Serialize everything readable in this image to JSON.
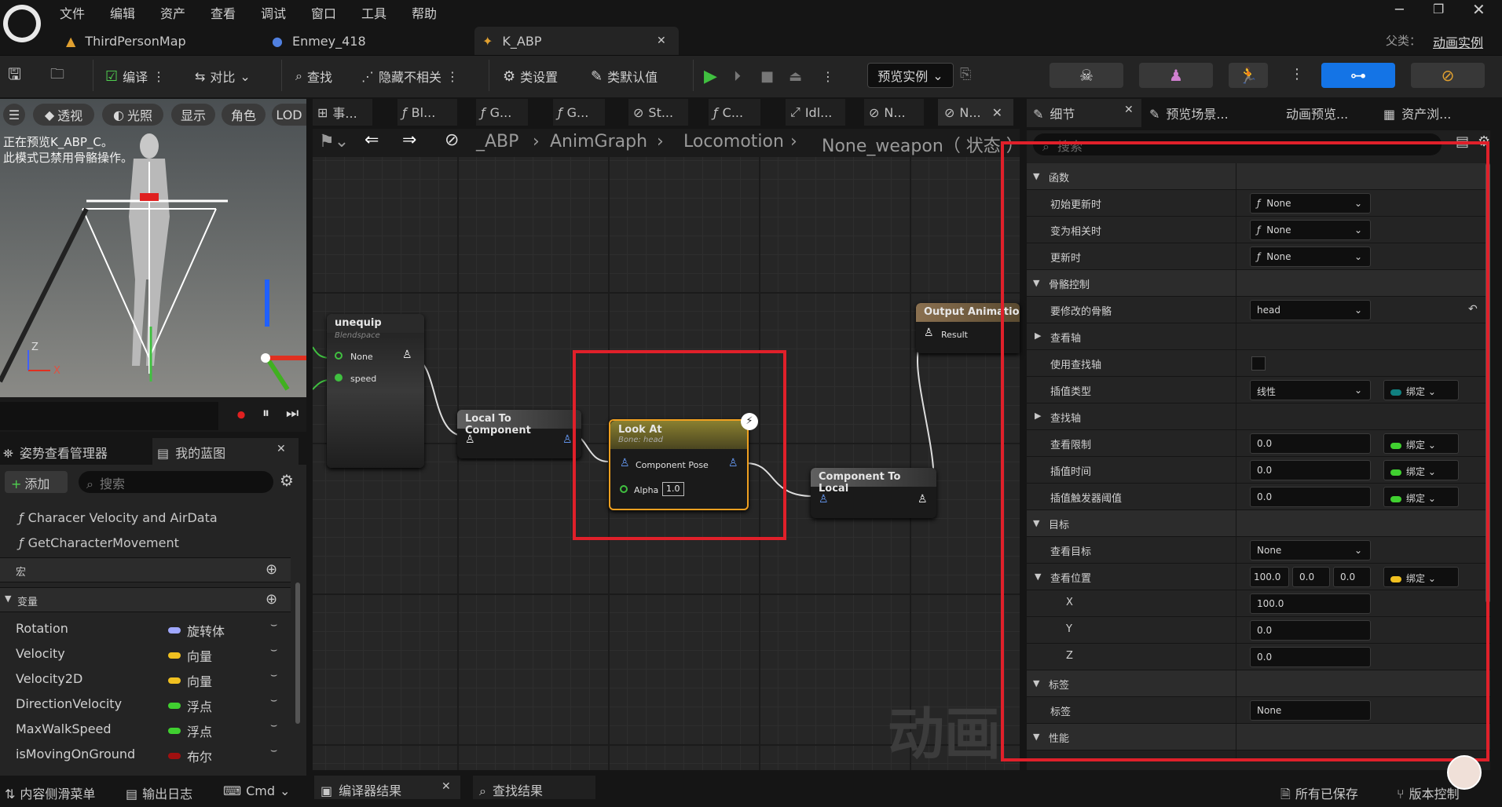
{
  "menu": [
    "文件",
    "编辑",
    "资产",
    "查看",
    "调试",
    "窗口",
    "工具",
    "帮助"
  ],
  "tabs": {
    "t1": "ThirdPersonMap",
    "t2": "Enmey_418",
    "t3": "K_ABP",
    "parent_label": "父类：",
    "parent_value": "动画实例"
  },
  "toolbar": {
    "compile": "编译",
    "diff": "对比",
    "find": "查找",
    "hide": "隐藏不相关",
    "class_settings": "类设置",
    "class_defaults": "类默认值",
    "preview_instance": "预览实例"
  },
  "viewport": {
    "b1": "透视",
    "b2": "光照",
    "b3": "显示",
    "b4": "角色",
    "b5": "LOD",
    "info1": "正在预览K_ABP_C。",
    "info2": "此模式已禁用骨骼操作。"
  },
  "graph_tabs": [
    "事...",
    "Bl...",
    "G...",
    "G...",
    "St...",
    "C...",
    "Idl...",
    "N...",
    "N..."
  ],
  "breadcrumb": [
    "_ABP",
    "AnimGraph",
    "Locomotion",
    "None_weapon（ 状态 ）"
  ],
  "nodes": {
    "unequip": {
      "title": "unequip",
      "sub": "Blendspace",
      "p1": "None",
      "p2": "speed"
    },
    "l2c": {
      "title": "Local To Component"
    },
    "lookat": {
      "title": "Look At",
      "sub": "Bone: head",
      "p1": "Component Pose",
      "p2": "Alpha",
      "alpha": "1.0"
    },
    "c2l": {
      "title": "Component To Local"
    },
    "out": {
      "title": "Output Animation Pose",
      "p1": "Result"
    },
    "watermark": "动画"
  },
  "panel_tabs": {
    "details": "细节",
    "preview_scene": "预览场景...",
    "anim_preview": "动画预览...",
    "asset_browser": "资产浏..."
  },
  "details": {
    "search": "搜索",
    "cat_func": "函数",
    "init_update": "初始更新时",
    "become_relevant": "变为相关时",
    "on_update": "更新时",
    "none": "None",
    "cat_skel": "骨骼控制",
    "bone_to_modify": "要修改的骨骼",
    "bone_val": "head",
    "look_axis": "查看轴",
    "use_lookup_axis": "使用查找轴",
    "interp_type": "插值类型",
    "interp_val": "线性",
    "bind": "绑定",
    "lookup_axis": "查找轴",
    "look_limit": "查看限制",
    "interp_time": "插值时间",
    "interp_trigger": "插值触发器阈值",
    "zero": "0.0",
    "cat_target": "目标",
    "look_target": "查看目标",
    "look_pos": "查看位置",
    "pos_x": "100.0",
    "pos_y": "0.0",
    "pos_z": "0.0",
    "x": "X",
    "y": "Y",
    "z": "Z",
    "pos_x_trunc": "100.0",
    "cat_tag": "标签",
    "tag": "标签",
    "tag_val": "None",
    "cat_perf": "性能"
  },
  "left": {
    "tab1": "姿势查看管理器",
    "tab2": "我的蓝图",
    "add": "添加",
    "search": "搜索",
    "fn1": "Characer Velocity and AirData",
    "fn2": "GetCharacterMovement",
    "macro": "宏",
    "vars": "变量",
    "var_rows": [
      {
        "name": "Rotation",
        "type": "旋转体",
        "color": "#a0a8ff"
      },
      {
        "name": "Velocity",
        "type": "向量",
        "color": "#f0c020"
      },
      {
        "name": "Velocity2D",
        "type": "向量",
        "color": "#f0c020"
      },
      {
        "name": "DirectionVelocity",
        "type": "浮点",
        "color": "#40d030"
      },
      {
        "name": "MaxWalkSpeed",
        "type": "浮点",
        "color": "#40d030"
      },
      {
        "name": "isMovingOnGround",
        "type": "布尔",
        "color": "#a01010"
      }
    ]
  },
  "bottom": {
    "content_drawer": "内容侧滑菜单",
    "output_log": "输出日志",
    "cmd": "Cmd",
    "compiler_results": "编译器结果",
    "find_results": "查找结果",
    "all_saved": "所有已保存",
    "version_control": "版本控制"
  }
}
